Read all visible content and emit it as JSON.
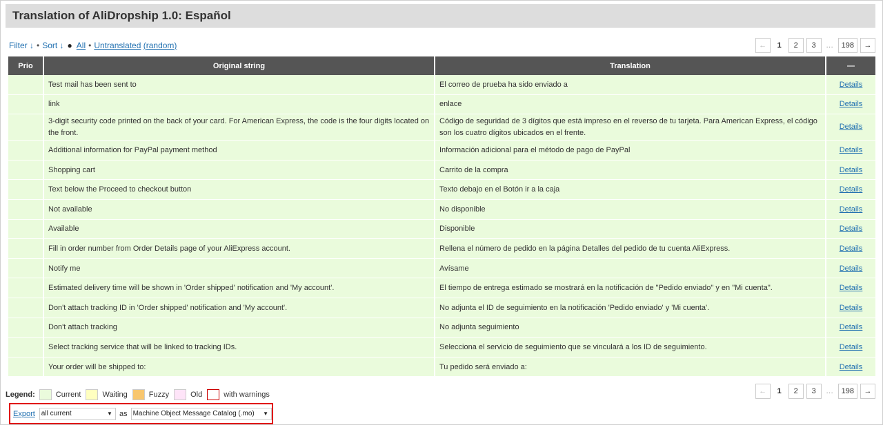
{
  "title": "Translation of AliDropship 1.0: Español",
  "toolbar": {
    "filter": "Filter ↓",
    "sort": "Sort ↓",
    "dot": "●",
    "all": "All",
    "untranslated": "Untranslated",
    "random": "(random)"
  },
  "pagination": {
    "prev": "←",
    "current": "1",
    "pages": [
      "2",
      "3"
    ],
    "ellipsis": "…",
    "last": "198",
    "next": "→"
  },
  "table": {
    "headers": [
      "Prio",
      "Original string",
      "Translation",
      "—"
    ],
    "details_label": "Details",
    "rows": [
      {
        "original": "Test mail has been sent to",
        "translation": "El correo de prueba ha sido enviado a"
      },
      {
        "original": "link",
        "translation": "enlace"
      },
      {
        "original": "3-digit security code printed on the back of your card. For American Express, the code is the four digits located on the front.",
        "translation": "Código de seguridad de 3 dígitos que está impreso en el reverso de tu tarjeta. Para American Express, el código son los cuatro dígitos ubicados en el frente."
      },
      {
        "original": "Additional information for PayPal payment method",
        "translation": "Información adicional para el método de pago de PayPal"
      },
      {
        "original": "Shopping cart",
        "translation": "Carrito de la compra"
      },
      {
        "original": "Text below the Proceed to checkout button",
        "translation": "Texto debajo en el Botón ir a la caja"
      },
      {
        "original": "Not available",
        "translation": "No disponible"
      },
      {
        "original": "Available",
        "translation": "Disponible"
      },
      {
        "original": "Fill in order number from Order Details page of your AliExpress account.",
        "translation": "Rellena el número de pedido en la página Detalles del pedido de tu cuenta AliExpress."
      },
      {
        "original": "Notify me",
        "translation": "Avísame"
      },
      {
        "original": "Estimated delivery time will be shown in 'Order shipped' notification and 'My account'.",
        "translation": "El tiempo de entrega estimado se mostrará en la notificación de \"Pedido enviado\" y en \"Mi cuenta\"."
      },
      {
        "original": "Don't attach tracking ID in 'Order shipped' notification and 'My account'.",
        "translation": "No adjunta el ID de seguimiento en la notificación 'Pedido enviado' y 'Mi cuenta'."
      },
      {
        "original": "Don't attach tracking",
        "translation": "No adjunta seguimiento"
      },
      {
        "original": "Select tracking service that will be linked to tracking IDs.",
        "translation": "Selecciona el servicio de seguimiento que se vinculará a los ID de seguimiento."
      },
      {
        "original": "Your order will be shipped to:",
        "translation": "Tu pedido será enviado a:"
      }
    ]
  },
  "legend": {
    "label": "Legend:",
    "items": [
      {
        "label": "Current",
        "color": "#eafbdc",
        "border": "#cccccc"
      },
      {
        "label": "Waiting",
        "color": "#ffffc0",
        "border": "#cccccc"
      },
      {
        "label": "Fuzzy",
        "color": "#f8c66e",
        "border": "#cccccc"
      },
      {
        "label": "Old",
        "color": "#fee4f8",
        "border": "#cccccc"
      },
      {
        "label": "with warnings",
        "color": "#ffffff",
        "border": "#cc0000"
      }
    ]
  },
  "export": {
    "link": "Export",
    "scope": "all current",
    "as": "as",
    "format": "Machine Object Message Catalog (.mo)"
  },
  "colors": {
    "header_bg": "#555555",
    "row_bg": "#eafbdc",
    "link": "#2271b1",
    "highlight_border": "#e00000"
  }
}
